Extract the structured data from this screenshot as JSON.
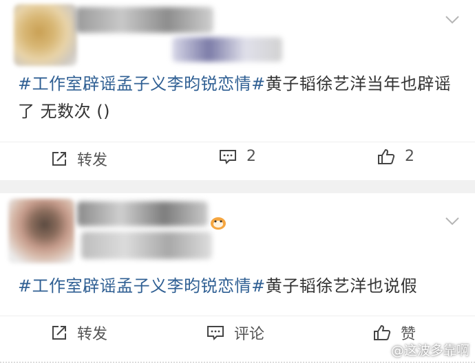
{
  "posts": [
    {
      "hashtag": "#工作室辟谣孟子义李昀锐恋情#",
      "text": "黄子韬徐艺洋当年也辟谣了 无数次 ()",
      "actions": {
        "repost_label": "转发",
        "comment_label": "2",
        "like_label": "2"
      }
    },
    {
      "hashtag": "#工作室辟谣孟子义李昀锐恋情#",
      "text": "黄子韬徐艺洋也说假",
      "actions": {
        "repost_label": "转发",
        "comment_label": "评论",
        "like_label": "赞"
      }
    }
  ],
  "watermark": {
    "text": "@这波多靠啊"
  },
  "icons": {
    "repost": "share-icon",
    "comment": "comment-icon",
    "like": "thumbs-up-icon",
    "more": "chevron-down-icon",
    "weibo": "weibo-logo-icon"
  }
}
